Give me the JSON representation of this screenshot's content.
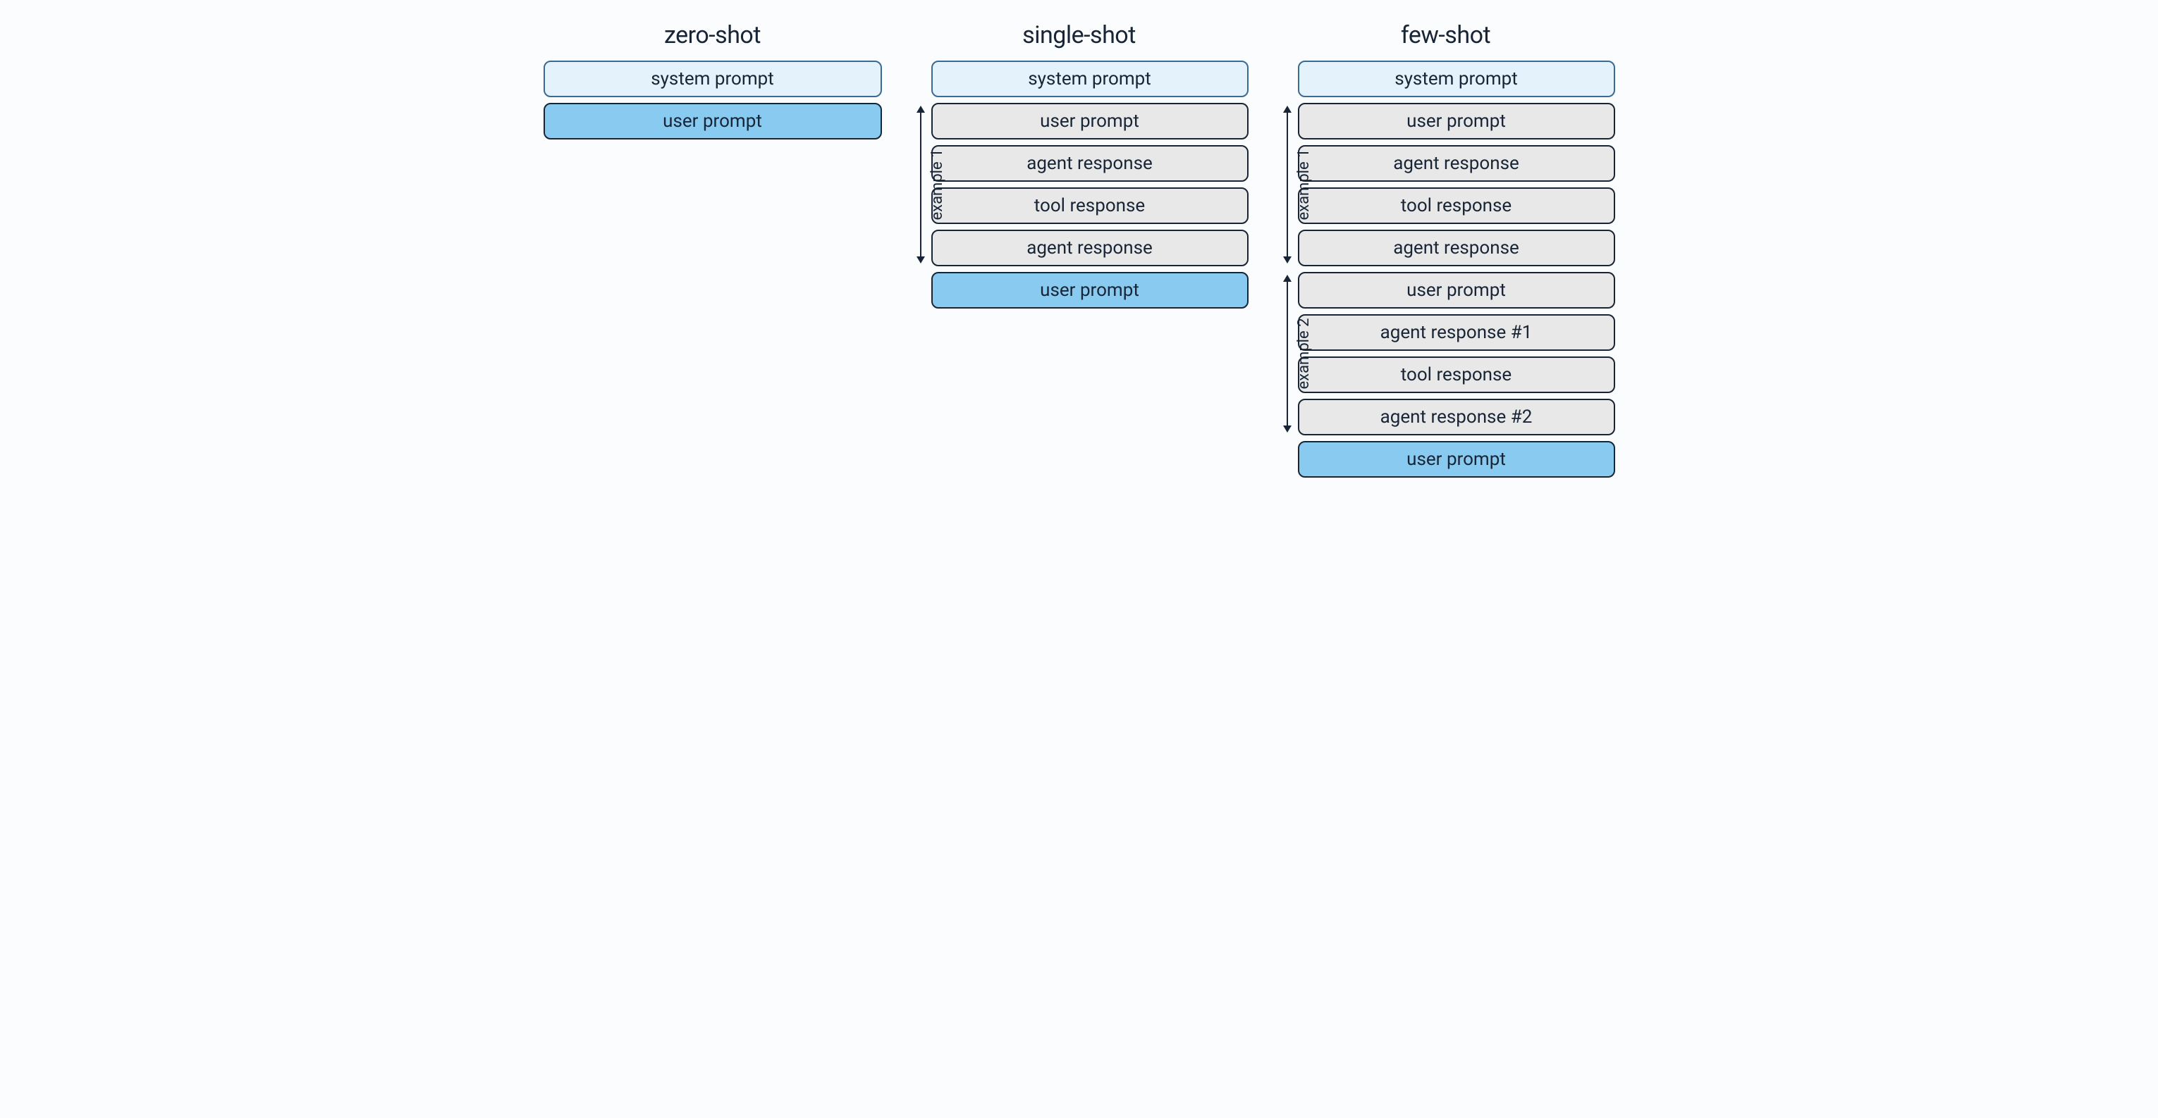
{
  "columns": [
    {
      "title": "zero-shot",
      "groups": [
        {
          "bracket": null,
          "items": [
            {
              "kind": "system",
              "label": "system prompt"
            },
            {
              "kind": "active",
              "label": "user prompt"
            }
          ]
        }
      ]
    },
    {
      "title": "single-shot",
      "groups": [
        {
          "bracket": null,
          "items": [
            {
              "kind": "system",
              "label": "system prompt"
            }
          ]
        },
        {
          "bracket": "example 1",
          "items": [
            {
              "kind": "gray",
              "label": "user prompt"
            },
            {
              "kind": "gray",
              "label": "agent response"
            },
            {
              "kind": "gray",
              "label": "tool response"
            },
            {
              "kind": "gray",
              "label": "agent response"
            }
          ]
        },
        {
          "bracket": null,
          "items": [
            {
              "kind": "active",
              "label": "user prompt"
            }
          ]
        }
      ]
    },
    {
      "title": "few-shot",
      "groups": [
        {
          "bracket": null,
          "items": [
            {
              "kind": "system",
              "label": "system prompt"
            }
          ]
        },
        {
          "bracket": "example 1",
          "items": [
            {
              "kind": "gray",
              "label": "user prompt"
            },
            {
              "kind": "gray",
              "label": "agent response"
            },
            {
              "kind": "gray",
              "label": "tool response"
            },
            {
              "kind": "gray",
              "label": "agent response"
            }
          ]
        },
        {
          "bracket": "example 2",
          "items": [
            {
              "kind": "gray",
              "label": "user prompt"
            },
            {
              "kind": "gray",
              "label": "agent response #1"
            },
            {
              "kind": "gray",
              "label": "tool response"
            },
            {
              "kind": "gray",
              "label": "agent response #2"
            }
          ]
        },
        {
          "bracket": null,
          "items": [
            {
              "kind": "active",
              "label": "user prompt"
            }
          ]
        }
      ]
    }
  ]
}
